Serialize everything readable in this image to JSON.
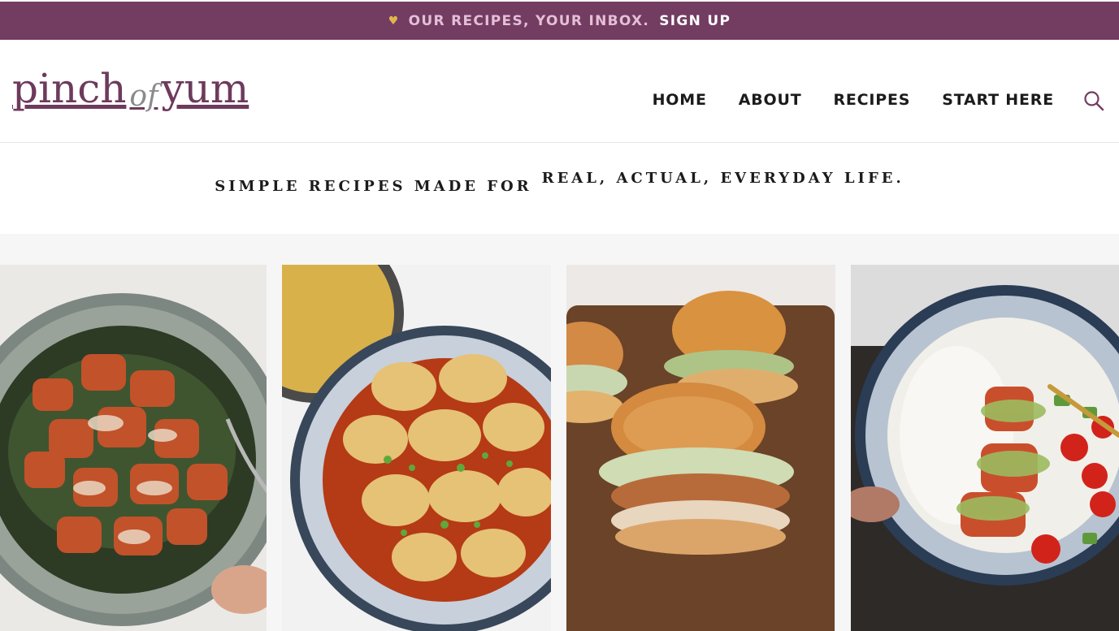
{
  "promo": {
    "heart_icon": "heart-icon",
    "text": "OUR RECIPES, YOUR INBOX.",
    "link": "SIGN UP"
  },
  "header": {
    "logo": {
      "word1": "pinch",
      "word2": "of",
      "word3": "yum"
    },
    "nav": [
      "HOME",
      "ABOUT",
      "RECIPES",
      "START HERE"
    ],
    "search_icon": "search-icon"
  },
  "tagline": {
    "part1": "SIMPLE RECIPES MADE FOR",
    "part2": "REAL, ACTUAL, EVERYDAY LIFE."
  },
  "recipes": [
    {
      "image": "orange-chicken-bowl-image"
    },
    {
      "image": "wonton-bowl-image"
    },
    {
      "image": "burger-board-image"
    },
    {
      "image": "salmon-rice-bowl-image"
    }
  ],
  "colors": {
    "brand_plum": "#733c61",
    "promo_pink": "#e4bfd8",
    "heart_gold": "#e0b74a",
    "nav_text": "#1b1b1b"
  }
}
